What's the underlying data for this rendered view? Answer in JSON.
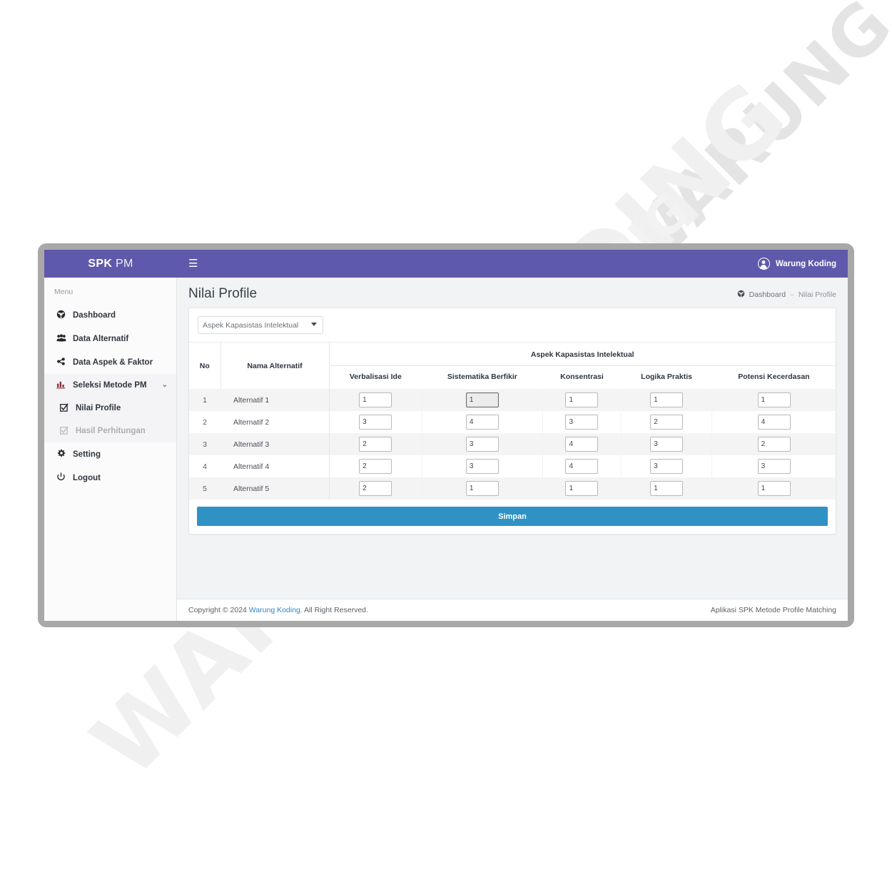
{
  "watermark": {
    "text_a": "WARUNG KODING",
    "text_b": "WARUNG KODING",
    "text_c": "WARUNG KODING"
  },
  "topbar": {
    "brand_bold": "SPK",
    "brand_light": "PM",
    "hamburger_icon": "hamburger-icon",
    "user_name": "Warung Koding",
    "user_icon": "user-circle-icon",
    "background": "#5f59ab"
  },
  "sidebar": {
    "heading": "Menu",
    "items": [
      {
        "label": "Dashboard",
        "icon": "dashboard-icon",
        "glyph": "⚽",
        "caret": ""
      },
      {
        "label": "Data Alternatif",
        "icon": "users-group-icon",
        "glyph": "👥",
        "caret": ""
      },
      {
        "label": "Data Aspek & Faktor",
        "icon": "sitemap-icon",
        "glyph": "⚙",
        "caret": ""
      },
      {
        "label": "Seleksi Metode PM",
        "icon": "bar-chart-icon",
        "glyph": "📊",
        "caret": "⌄"
      },
      {
        "label": "Nilai Profile",
        "icon": "checkbox-checked-icon",
        "glyph": "☑",
        "caret": ""
      },
      {
        "label": "Hasil Perhitungan",
        "icon": "checkbox-checked-icon",
        "glyph": "☑",
        "caret": ""
      },
      {
        "label": "Setting",
        "icon": "gear-icon",
        "glyph": "⚙",
        "caret": "‹"
      },
      {
        "label": "Logout",
        "icon": "power-icon",
        "glyph": "⏻",
        "caret": ""
      }
    ]
  },
  "page": {
    "title": "Nilai Profile",
    "breadcrumb": {
      "home_icon": "dashboard-icon",
      "home_label": "Dashboard",
      "separator": "–",
      "current_label": "Nilai Profile"
    }
  },
  "card": {
    "aspect_select": {
      "selected": "Aspek Kapasistas Intelektual",
      "options": [
        "Aspek Kapasistas Intelektual"
      ],
      "caret_icon": "chevron-down-icon"
    },
    "table": {
      "col_no": "No",
      "col_name": "Nama Alternatif",
      "group_header": "Aspek Kapasistas Intelektual",
      "sub_headers": [
        "Verbalisasi Ide",
        "Sistematika Berfikir",
        "Konsentrasi",
        "Logika Praktis",
        "Potensi Kecerdasan"
      ],
      "rows": [
        {
          "no": "1",
          "name": "Alternatif 1",
          "values": [
            "1",
            "1",
            "1",
            "1",
            "1"
          ],
          "focused_index": 1
        },
        {
          "no": "2",
          "name": "Alternatif 2",
          "values": [
            "3",
            "4",
            "3",
            "2",
            "4"
          ],
          "focused_index": -1
        },
        {
          "no": "3",
          "name": "Alternatif 3",
          "values": [
            "2",
            "3",
            "4",
            "3",
            "2"
          ],
          "focused_index": -1
        },
        {
          "no": "4",
          "name": "Alternatif 4",
          "values": [
            "2",
            "3",
            "4",
            "3",
            "3"
          ],
          "focused_index": -1
        },
        {
          "no": "5",
          "name": "Alternatif 5",
          "values": [
            "2",
            "1",
            "1",
            "1",
            "1"
          ],
          "focused_index": -1
        }
      ]
    },
    "save_label": "Simpan",
    "save_color": "#3092c4"
  },
  "footer": {
    "copyright_prefix": "Copyright © 2024 ",
    "copyright_link": "Warung Koding",
    "copyright_suffix": ". All Right Reserved.",
    "right_text": "Aplikasi SPK Metode Profile Matching"
  }
}
